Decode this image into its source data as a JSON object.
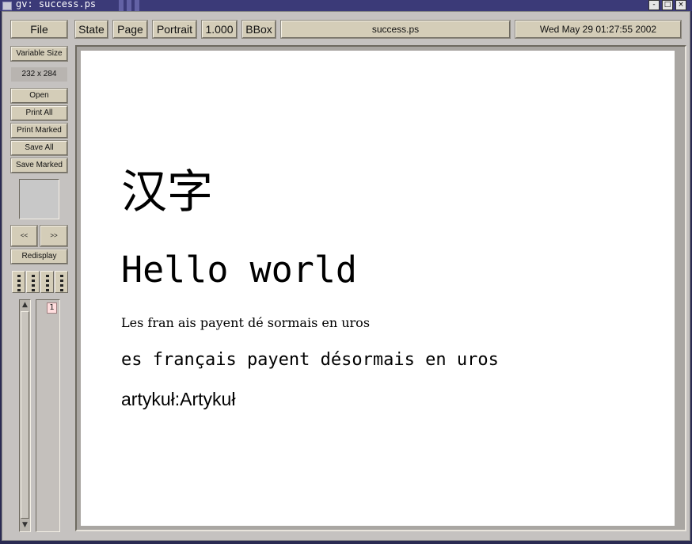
{
  "window": {
    "title": "gv: success.ps",
    "controls": {
      "minimize": "-",
      "maximize": "□",
      "close": "×"
    }
  },
  "toolbar": {
    "file": "File",
    "state": "State",
    "page": "Page",
    "orientation": "Portrait",
    "magnification": "1.000",
    "bbox": "BBox",
    "filename": "success.ps",
    "date": "Wed May 29 01:27:55 2002"
  },
  "sidebar": {
    "size_mode": "Variable Size",
    "size_readout": "232 x 284",
    "open": "Open",
    "print_all": "Print All",
    "print_marked": "Print Marked",
    "save_all": "Save All",
    "save_marked": "Save Marked",
    "prev_page": "<<",
    "next_page": ">>",
    "redisplay": "Redisplay",
    "scroll_up": "▲",
    "scroll_down": "▼",
    "pages": [
      "1"
    ]
  },
  "document": {
    "line_han": "汉字",
    "line_hello": "Hello world",
    "line_fr1": "Les fran  ais payent dé sormais en   uros",
    "line_fr2": "es français payent désormais en  uros",
    "line_artykul": "artykuł:Artykuł"
  }
}
